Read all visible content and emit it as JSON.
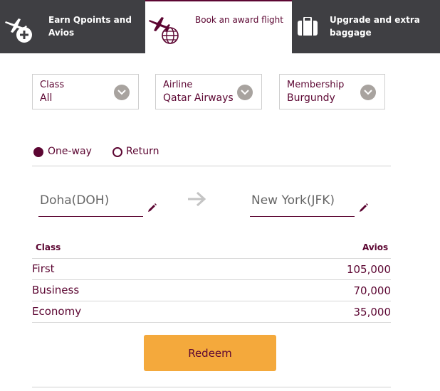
{
  "tabs": [
    {
      "label": "Earn Qpoints and Avios",
      "line1": "Earn Qpoints and",
      "line2": "Avios",
      "icon": "plane-plus-icon"
    },
    {
      "label": "Book an award flight",
      "icon": "plane-globe-icon"
    },
    {
      "label": "Upgrade and extra baggage",
      "line1": "Upgrade and extra",
      "line2": "baggage",
      "icon": "suitcase-icon"
    }
  ],
  "filters": {
    "class": {
      "label": "Class",
      "value": "All"
    },
    "airline": {
      "label": "Airline",
      "value": "Qatar Airways"
    },
    "membership": {
      "label": "Membership",
      "value": "Burgundy"
    }
  },
  "trip_type": {
    "selected": "One-way",
    "options": [
      "One-way",
      "Return"
    ]
  },
  "route": {
    "from": "Doha(DOH)",
    "to": "New York(JFK)"
  },
  "table": {
    "headers": {
      "class": "Class",
      "avios": "Avios"
    },
    "rows": [
      {
        "class": "First",
        "avios": "105,000"
      },
      {
        "class": "Business",
        "avios": "70,000"
      },
      {
        "class": "Economy",
        "avios": "35,000"
      }
    ]
  },
  "redeem_label": "Redeem",
  "colors": {
    "brand": "#5c0632",
    "accent": "#f4a93c",
    "tab_dark": "#3f3f43",
    "chevron": "#a8a39f"
  }
}
